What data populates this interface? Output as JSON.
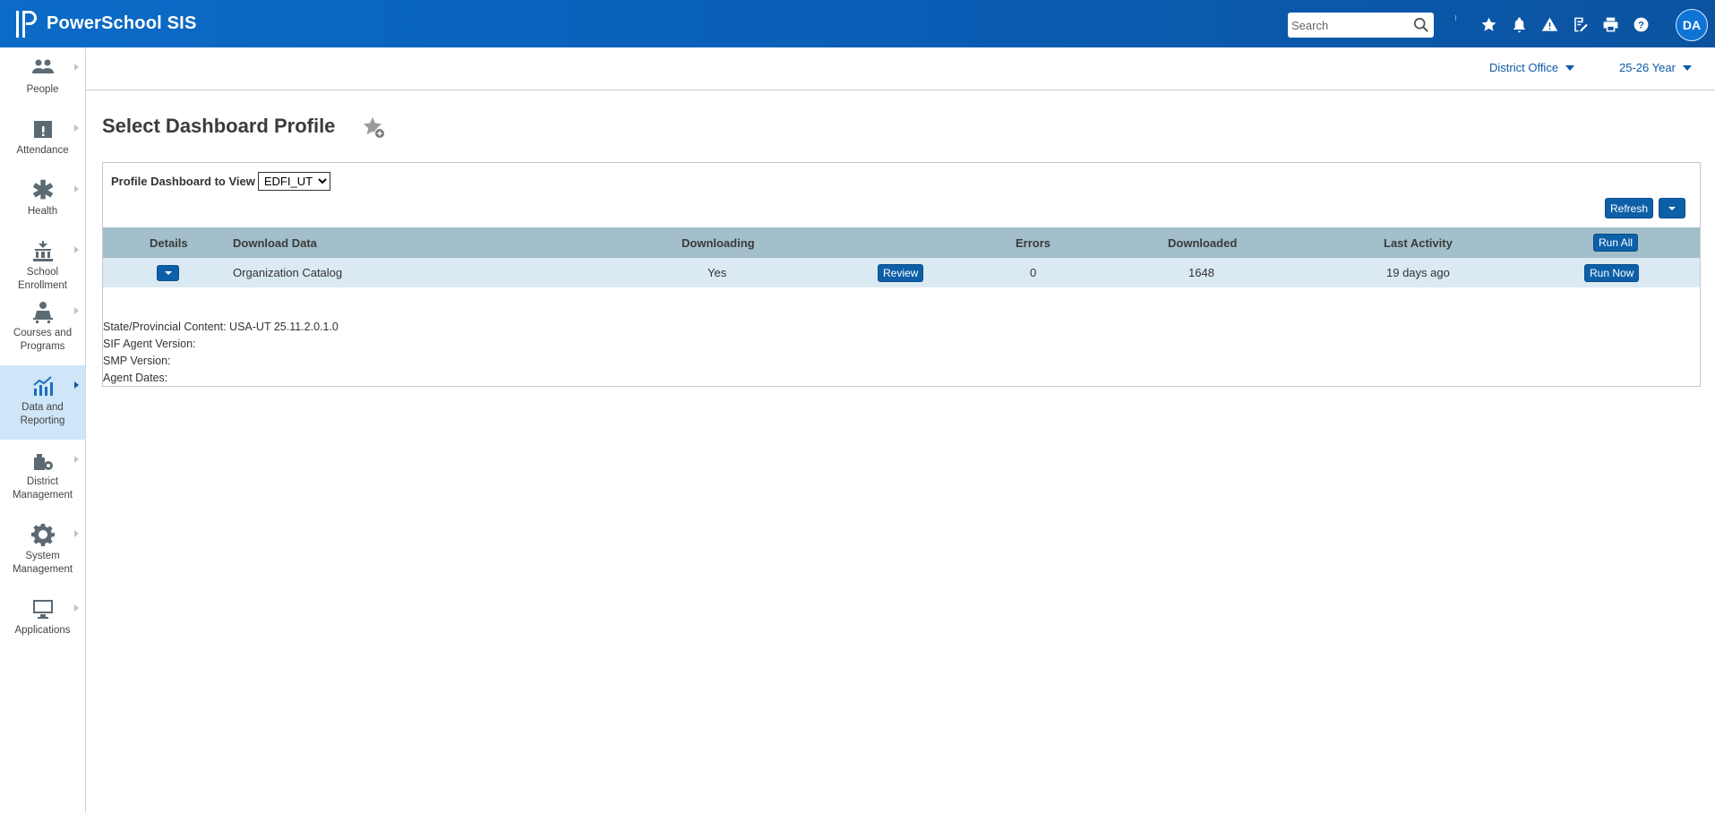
{
  "header": {
    "app_name": "PowerSchool SIS",
    "search_placeholder": "Search",
    "avatar_initials": "DA",
    "icons": [
      "star-icon",
      "bell-icon",
      "alert-icon",
      "edit-form-icon",
      "print-icon",
      "help-icon"
    ],
    "brand_color": "#0a5db4"
  },
  "sidebar": {
    "items": [
      {
        "label": "People",
        "icon": "people-icon"
      },
      {
        "label": "Attendance",
        "icon": "attendance-icon"
      },
      {
        "label": "Health",
        "icon": "health-icon"
      },
      {
        "label": "School Enrollment",
        "icon": "school-icon"
      },
      {
        "label": "Courses and Programs",
        "icon": "courses-icon"
      },
      {
        "label": "Data and Reporting",
        "icon": "chart-icon",
        "active": true
      },
      {
        "label": "District Management",
        "icon": "district-icon"
      },
      {
        "label": "System Management",
        "icon": "gear-icon"
      },
      {
        "label": "Applications",
        "icon": "monitor-icon"
      }
    ]
  },
  "subbar": {
    "school": "District Office",
    "term": "25-26 Year"
  },
  "page": {
    "title": "Select Dashboard Profile"
  },
  "panel": {
    "profile_label": "Profile Dashboard to View",
    "profile_options": [
      "EDFI_UT"
    ],
    "profile_selected": "EDFI_UT",
    "refresh_label": "Refresh",
    "columns": {
      "details": "Details",
      "download_data": "Download Data",
      "downloading": "Downloading",
      "errors": "Errors",
      "downloaded": "Downloaded",
      "last_activity": "Last Activity",
      "run_all": "Run All"
    },
    "rows": [
      {
        "download_data": "Organization Catalog",
        "downloading": "Yes",
        "review": "Review",
        "errors": "0",
        "downloaded": "1648",
        "last_activity": "19 days ago",
        "run_now": "Run Now"
      }
    ],
    "info": {
      "state_content": "State/Provincial Content: USA-UT 25.11.2.0.1.0",
      "sif_agent": "SIF Agent Version:",
      "smp_version": "SMP Version:",
      "agent_dates": "Agent Dates:"
    }
  }
}
